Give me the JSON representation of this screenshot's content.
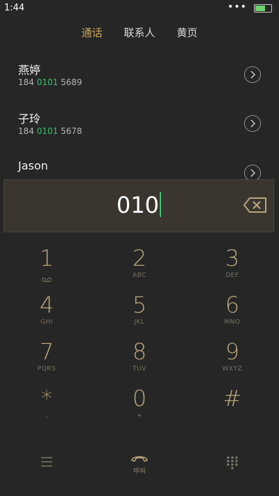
{
  "status_bar": {
    "time": "1:44",
    "dots": "•••"
  },
  "tabs": [
    {
      "label": "通话",
      "active": true
    },
    {
      "label": "联系人",
      "active": false
    },
    {
      "label": "黄页",
      "active": false
    }
  ],
  "contacts": [
    {
      "name": "燕婷",
      "number_prefix": "184 ",
      "number_match": "0101",
      "number_suffix": " 5689"
    },
    {
      "name": "子玲",
      "number_prefix": "184 ",
      "number_match": "0101",
      "number_suffix": " 5678"
    },
    {
      "name": "Jason"
    }
  ],
  "dial_input": {
    "value": "010"
  },
  "keypad": [
    {
      "digit": "1",
      "letters": ""
    },
    {
      "digit": "2",
      "letters": "ABC"
    },
    {
      "digit": "3",
      "letters": "DEF"
    },
    {
      "digit": "4",
      "letters": "GHI"
    },
    {
      "digit": "5",
      "letters": "JKL"
    },
    {
      "digit": "6",
      "letters": "MNO"
    },
    {
      "digit": "7",
      "letters": "PQRS"
    },
    {
      "digit": "8",
      "letters": "TUV"
    },
    {
      "digit": "9",
      "letters": "WXYZ"
    },
    {
      "digit": "*",
      "letters": ","
    },
    {
      "digit": "0",
      "letters": "+"
    },
    {
      "digit": "#",
      "letters": ""
    }
  ],
  "bottom_bar": {
    "call_label": "呼叫"
  },
  "colors": {
    "accent": "#c4a45f",
    "match": "#3ac06e",
    "background": "#262626",
    "key_digit": "#b8a57b"
  }
}
